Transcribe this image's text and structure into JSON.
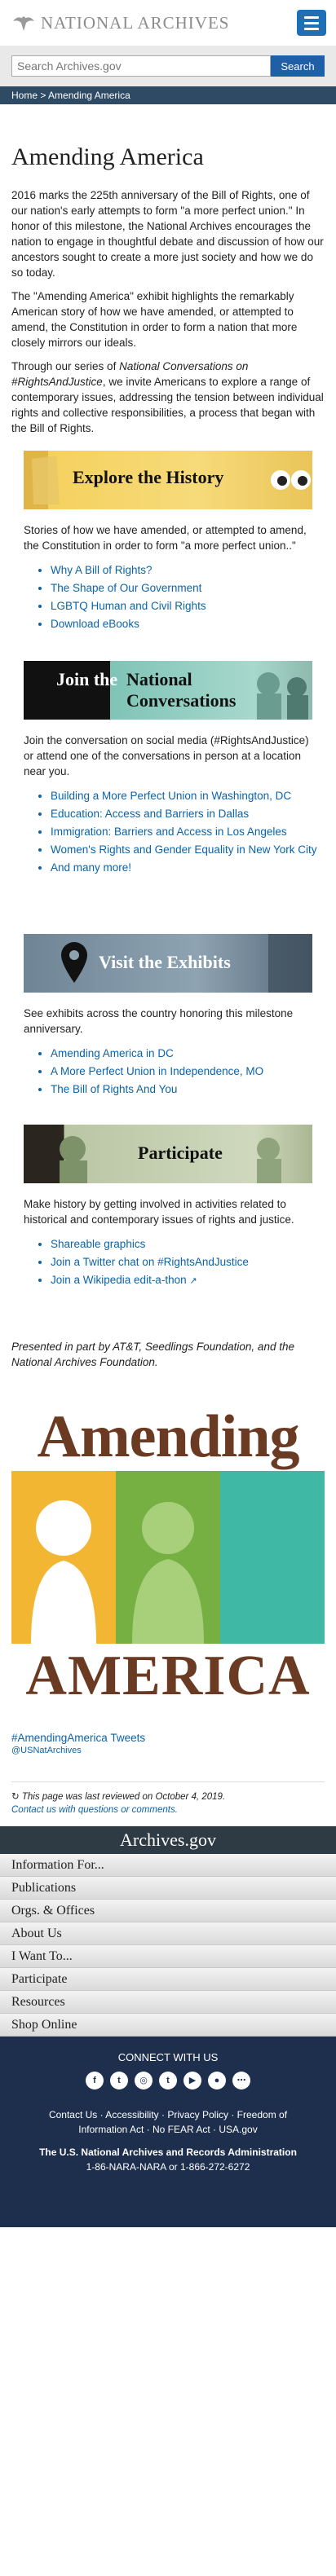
{
  "header": {
    "logo_text": "NATIONAL ARCHIVES",
    "search_placeholder": "Search Archives.gov",
    "search_button": "Search"
  },
  "breadcrumb": {
    "home": "Home",
    "separator": ">",
    "current": "Amending America"
  },
  "main": {
    "title": "Amending America",
    "intro_1": "2016 marks the 225th anniversary of the Bill of Rights, one of our nation's early attempts to form \"a more perfect union.\"     In honor of this milestone, the National Archives encourages the nation to engage in thoughtful debate and discussion of how our ancestors sought to create a more just society and how we do so today.",
    "intro_2": "The \"Amending America\"     exhibit highlights the remarkably American story of how we have amended, or attempted to amend, the Constitution in order to form a nation that more closely mirrors our ideals.",
    "intro_3_prefix": "Through our series of ",
    "intro_3_em": "National Conversations on #RightsAndJustice",
    "intro_3_suffix": ", we invite Americans to explore a range of contemporary issues, addressing the tension between individual rights and collective responsibilities, a process that began with the Bill of Rights."
  },
  "sections": {
    "explore": {
      "banner": "Explore the History",
      "text": "Stories of how we have amended, or attempted to amend, the Constitution in order to form \"a more perfect union..\"",
      "links": [
        "Why A Bill of Rights?",
        "The Shape of Our Government",
        "LGBTQ Human and Civil Rights",
        "Download eBooks"
      ]
    },
    "conversations": {
      "banner_1": "Join the",
      "banner_2": "National",
      "banner_3": "Conversations",
      "text": "Join the conversation on social media (#RightsAndJustice) or attend one of the conversations in person at a location near you.",
      "links": [
        "Building a More Perfect Union in Washington, DC",
        "Education: Access and Barriers in Dallas",
        "Immigration: Barriers and Access in Los Angeles",
        "Women's Rights and Gender Equality in New York City",
        "And many more!"
      ]
    },
    "exhibits": {
      "banner": "Visit the Exhibits",
      "text": "See exhibits across the country honoring this milestone anniversary.",
      "links": [
        "Amending America in DC",
        "A  More Perfect Union in Independence, MO",
        "The Bill of Rights And You"
      ]
    },
    "participate": {
      "banner": "Participate",
      "text": "Make history by getting involved in activities related to historical and contemporary issues of rights and justice.",
      "links": [
        "Shareable graphics",
        "Join a Twitter chat on #RightsAndJustice",
        "Join a Wikipedia edit-a-thon"
      ]
    }
  },
  "credit": "Presented in part by AT&T, Seedlings Foundation, and the National Archives Foundation.",
  "poster": {
    "top": "Amending",
    "bottom": "AMERICA",
    "colors": [
      "#f2b632",
      "#76b043",
      "#3fb8a6"
    ]
  },
  "tweets": {
    "title": "#AmendingAmerica Tweets",
    "handle": "@USNatArchives"
  },
  "review": {
    "text": "This page was last reviewed on October 4, 2019.",
    "contact": "Contact us with questions or comments."
  },
  "footer": {
    "band": "Archives.gov",
    "menu": [
      "Information For...",
      "Publications",
      "Orgs. & Offices",
      "About Us",
      "I Want To...",
      "Participate",
      "Resources",
      "Shop Online"
    ],
    "connect": "CONNECT WITH US",
    "social": [
      "f",
      "t",
      "◎",
      "t",
      "▶",
      "●",
      "⋯"
    ],
    "links_1": "Contact Us · Accessibility · Privacy Policy · Freedom of Information Act · No FEAR Act · USA.gov",
    "org": "The U.S. National Archives and Records Administration",
    "phone": "1-86-NARA-NARA or 1-866-272-6272"
  }
}
